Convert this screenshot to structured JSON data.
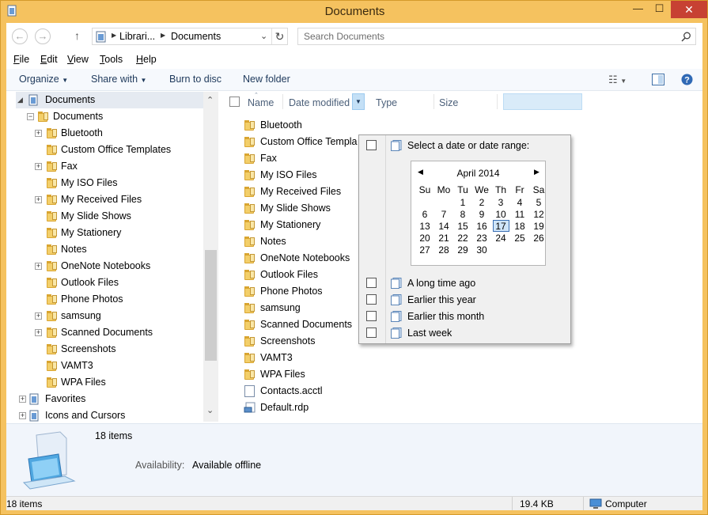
{
  "window": {
    "title": "Documents"
  },
  "address": {
    "crumbs": [
      "Librari...",
      "Documents"
    ],
    "sep": "▶"
  },
  "search": {
    "placeholder": "Search Documents"
  },
  "menu": [
    "File",
    "Edit",
    "View",
    "Tools",
    "Help"
  ],
  "menu_underline": [
    "F",
    "E",
    "V",
    "T",
    "H"
  ],
  "menu_rest": [
    "ile",
    "dit",
    "iew",
    "ools",
    "elp"
  ],
  "toolbar": {
    "organize": "Organize",
    "share_with": "Share with",
    "burn": "Burn to disc",
    "new_folder": "New folder"
  },
  "tree": {
    "root": "Documents",
    "lib": "Documents",
    "items": [
      "Bluetooth",
      "Custom Office Templates",
      "Fax",
      "My ISO Files",
      "My Received Files",
      "My Slide Shows",
      "My Stationery",
      "Notes",
      "OneNote Notebooks",
      "Outlook Files",
      "Phone Photos",
      "samsung",
      "Scanned Documents",
      "Screenshots",
      "VAMT3",
      "WPA Files"
    ],
    "favorites": "Favorites",
    "icons_cursors": "Icons and Cursors"
  },
  "columns": {
    "name": "Name",
    "date_modified": "Date modified",
    "type": "Type",
    "size": "Size"
  },
  "files": [
    "Bluetooth",
    "Custom Office Templa",
    "Fax",
    "My ISO Files",
    "My Received Files",
    "My Slide Shows",
    "My Stationery",
    "Notes",
    "OneNote Notebooks",
    "Outlook Files",
    "Phone Photos",
    "samsung",
    "Scanned Documents",
    "Screenshots",
    "VAMT3",
    "WPA Files",
    "Contacts.acctl",
    "Default.rdp"
  ],
  "date_filter": {
    "select_range": "Select a date or date range:",
    "calendar": {
      "month": "April 2014",
      "weekdays": [
        "Su",
        "Mo",
        "Tu",
        "We",
        "Th",
        "Fr",
        "Sa"
      ],
      "weeks": [
        [
          "",
          "",
          "1",
          "2",
          "3",
          "4",
          "5"
        ],
        [
          "6",
          "7",
          "8",
          "9",
          "10",
          "11",
          "12"
        ],
        [
          "13",
          "14",
          "15",
          "16",
          "17",
          "18",
          "19"
        ],
        [
          "20",
          "21",
          "22",
          "23",
          "24",
          "25",
          "26"
        ],
        [
          "27",
          "28",
          "29",
          "30",
          "",
          "",
          ""
        ]
      ],
      "selected": "17"
    },
    "options": [
      "A long time ago",
      "Earlier this year",
      "Earlier this month",
      "Last week"
    ]
  },
  "details": {
    "count": "18 items",
    "availability_label": "Availability:",
    "availability_value": "Available offline"
  },
  "status": {
    "items": "18 items",
    "size": "19.4 KB",
    "location": "Computer"
  }
}
